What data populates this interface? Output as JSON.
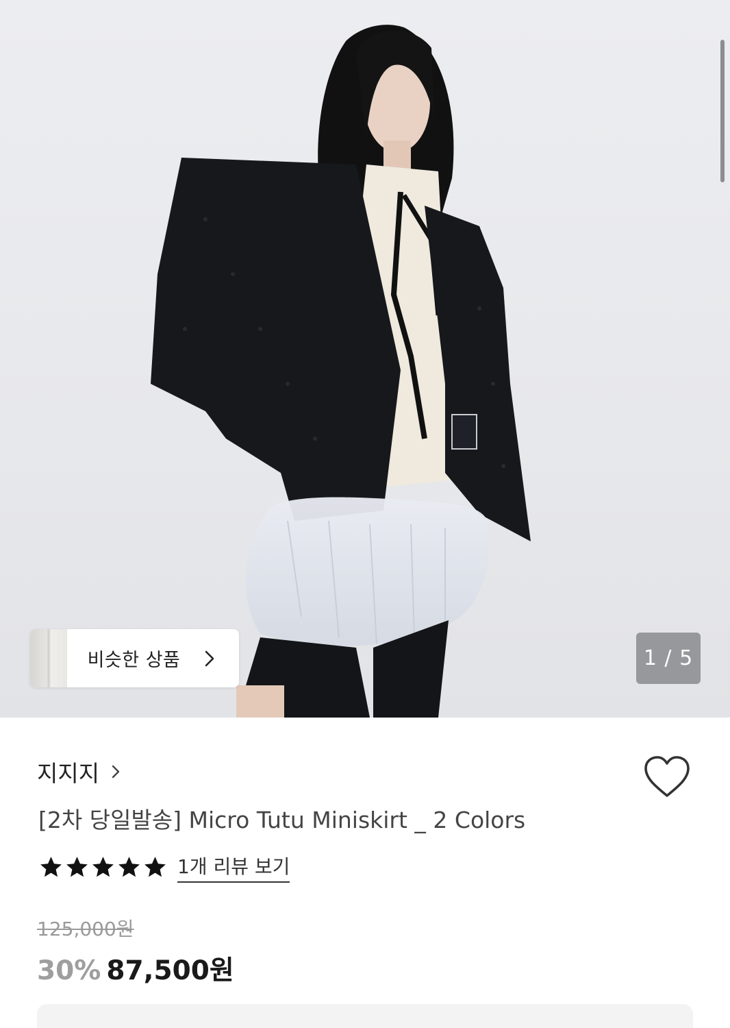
{
  "hero": {
    "similar_button": {
      "label": "비슷한 상품",
      "chevron": "›",
      "thumbnail": "product-thumbnail"
    },
    "page_indicator": "1 / 5"
  },
  "product": {
    "brand": "지지지",
    "brand_chevron": "›",
    "title": "[2차 당일발송] Micro Tutu Miniskirt _ 2 Colors",
    "rating": {
      "stars": 5,
      "max": 5,
      "review_link": "1개 리뷰 보기"
    },
    "original_price": "125,000원",
    "discount": "30%",
    "sale_price": "87,500원"
  },
  "icons": {
    "heart": "heart-outline-icon",
    "star": "star-filled-icon"
  },
  "colors": {
    "text_primary": "#222222",
    "text_muted": "#9e9e9e",
    "indicator_bg": "#787a7e"
  }
}
